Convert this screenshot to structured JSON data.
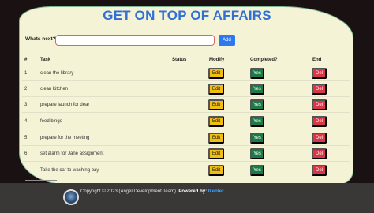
{
  "header": {
    "title": "GET ON TOP OF AFFAIRS"
  },
  "form": {
    "label": "Whats next?",
    "input_value": "",
    "add_label": "Add"
  },
  "table": {
    "columns": [
      "#",
      "Task",
      "Status",
      "Modify",
      "Completed?",
      "End"
    ],
    "rows": [
      {
        "num": "1",
        "task": "clean the library",
        "status": "",
        "edit": "Edit",
        "yes": "Yes",
        "del": "Del"
      },
      {
        "num": "2",
        "task": "clean kitchen",
        "status": "",
        "edit": "Edit",
        "yes": "Yes",
        "del": "Del"
      },
      {
        "num": "3",
        "task": "prepare launch for dear",
        "status": "",
        "edit": "Edit",
        "yes": "Yes",
        "del": "Del"
      },
      {
        "num": "4",
        "task": "feed bingo",
        "status": "",
        "edit": "Edit",
        "yes": "Yes",
        "del": "Del"
      },
      {
        "num": "5",
        "task": "prepare for the meeting",
        "status": "",
        "edit": "Edit",
        "yes": "Yes",
        "del": "Del"
      },
      {
        "num": "6",
        "task": "set alarm for Jane assignment",
        "status": "",
        "edit": "Edit",
        "yes": "Yes",
        "del": "Del"
      },
      {
        "num": "",
        "task": "Take the car to washing bay",
        "status": "",
        "edit": "Edit",
        "yes": "Yes",
        "del": "Del"
      }
    ]
  },
  "footer": {
    "copyright": "Copyright © 2023 (Angel Development Team).",
    "powered_by": "Powered by:",
    "brand": "Ikenter"
  },
  "colors": {
    "title": "#2f6fd6",
    "card_bg": "#f5f3d6",
    "edit": "#f2be12",
    "yes": "#1c7a46",
    "del": "#dc3545",
    "add": "#2b78f0"
  }
}
